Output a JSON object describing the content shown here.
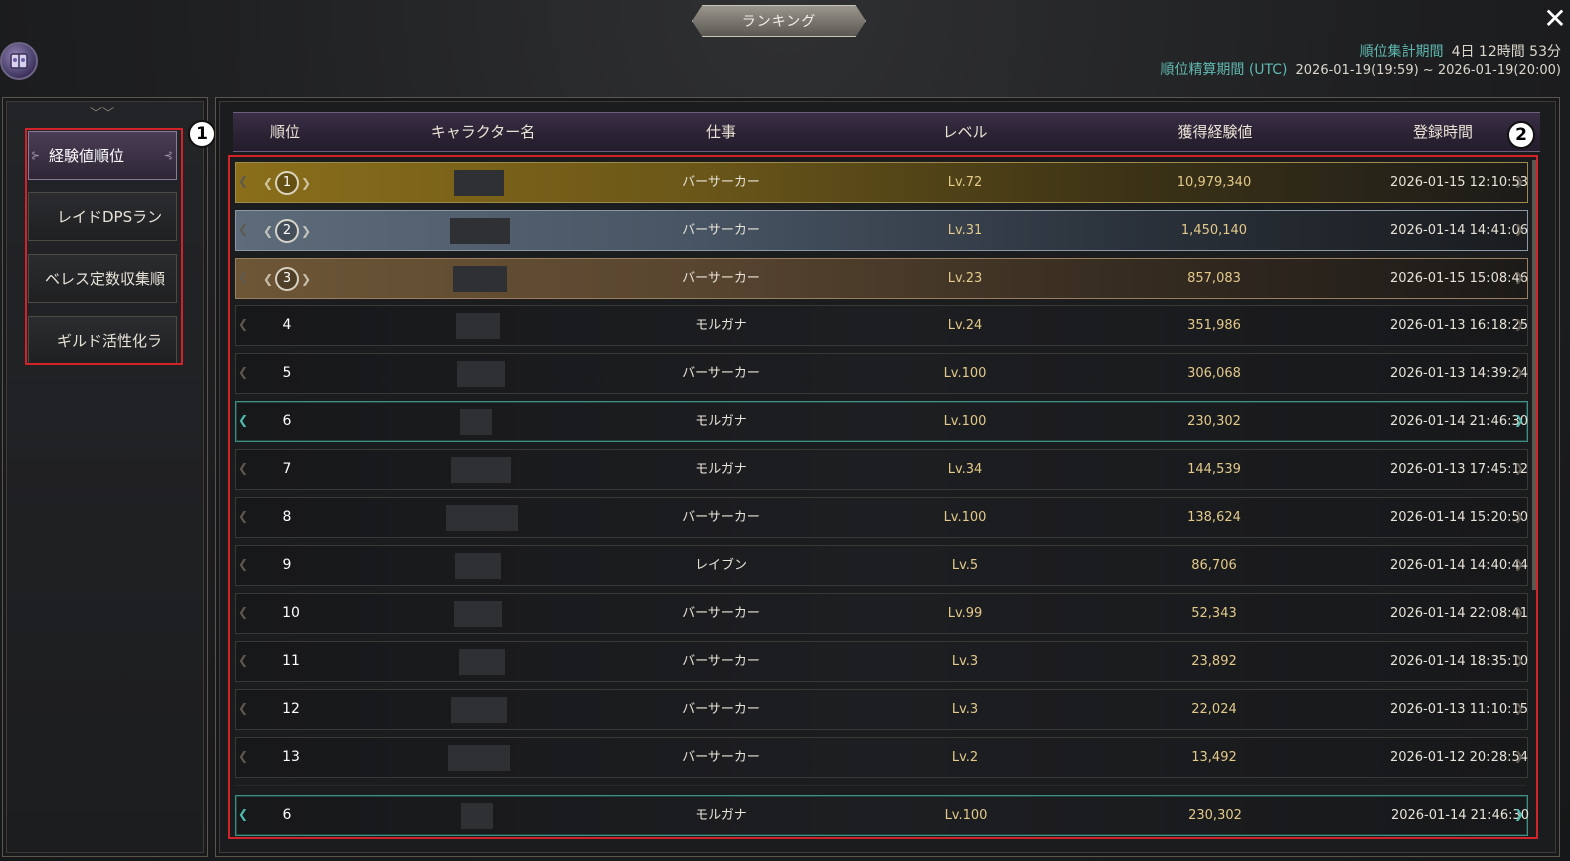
{
  "window": {
    "title": "ランキング",
    "close_icon": "close-icon"
  },
  "period": {
    "aggregation_label": "順位集計期間",
    "aggregation_value": "4日 12時間 53分",
    "settlement_label": "順位精算期間 (UTC)",
    "settlement_value": "2026-01-19(19:59) ~ 2026-01-19(20:00)"
  },
  "sidebar": {
    "tabs": [
      {
        "label": "経験値順位",
        "active": true
      },
      {
        "label": "レイドDPSラン",
        "active": false
      },
      {
        "label": "ベレス定数収集順",
        "active": false
      },
      {
        "label": "ギルド活性化ラ",
        "active": false
      }
    ]
  },
  "annotations": {
    "badge_1": "1",
    "badge_2": "2"
  },
  "table": {
    "headers": {
      "rank": "順位",
      "name": "キャラクター名",
      "job": "仕事",
      "level": "レベル",
      "exp": "獲得経験値",
      "time": "登録時間"
    },
    "rows": [
      {
        "rank": "1",
        "job": "バーサーカー",
        "level": "Lv.72",
        "exp": "10,979,340",
        "time": "2026-01-15 12:10:53",
        "tier": "gold"
      },
      {
        "rank": "2",
        "job": "バーサーカー",
        "level": "Lv.31",
        "exp": "1,450,140",
        "time": "2026-01-14 14:41:06",
        "tier": "silver"
      },
      {
        "rank": "3",
        "job": "バーサーカー",
        "level": "Lv.23",
        "exp": "857,083",
        "time": "2026-01-15 15:08:46",
        "tier": "bronze"
      },
      {
        "rank": "4",
        "job": "モルガナ",
        "level": "Lv.24",
        "exp": "351,986",
        "time": "2026-01-13 16:18:25",
        "tier": "normal"
      },
      {
        "rank": "5",
        "job": "バーサーカー",
        "level": "Lv.100",
        "exp": "306,068",
        "time": "2026-01-13 14:39:24",
        "tier": "normal"
      },
      {
        "rank": "6",
        "job": "モルガナ",
        "level": "Lv.100",
        "exp": "230,302",
        "time": "2026-01-14 21:46:30",
        "tier": "me"
      },
      {
        "rank": "7",
        "job": "モルガナ",
        "level": "Lv.34",
        "exp": "144,539",
        "time": "2026-01-13 17:45:12",
        "tier": "normal"
      },
      {
        "rank": "8",
        "job": "バーサーカー",
        "level": "Lv.100",
        "exp": "138,624",
        "time": "2026-01-14 15:20:50",
        "tier": "normal"
      },
      {
        "rank": "9",
        "job": "レイブン",
        "level": "Lv.5",
        "exp": "86,706",
        "time": "2026-01-14 14:40:44",
        "tier": "normal"
      },
      {
        "rank": "10",
        "job": "バーサーカー",
        "level": "Lv.99",
        "exp": "52,343",
        "time": "2026-01-14 22:08:41",
        "tier": "normal"
      },
      {
        "rank": "11",
        "job": "バーサーカー",
        "level": "Lv.3",
        "exp": "23,892",
        "time": "2026-01-14 18:35:10",
        "tier": "normal"
      },
      {
        "rank": "12",
        "job": "バーサーカー",
        "level": "Lv.3",
        "exp": "22,024",
        "time": "2026-01-13 11:10:15",
        "tier": "normal"
      },
      {
        "rank": "13",
        "job": "バーサーカー",
        "level": "Lv.2",
        "exp": "13,492",
        "time": "2026-01-12 20:28:54",
        "tier": "normal"
      }
    ],
    "my_row": {
      "rank": "6",
      "job": "モルガナ",
      "level": "Lv.100",
      "exp": "230,302",
      "time": "2026-01-14 21:46:30",
      "tier": "me"
    }
  }
}
